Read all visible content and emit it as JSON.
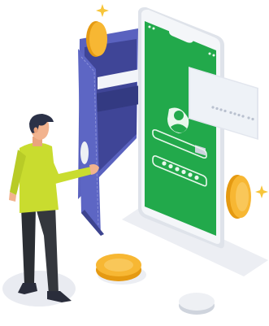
{
  "illustration": {
    "palette": {
      "screen": "#22a94b",
      "phone_frame": "#eef0f4",
      "wallet": "#4e56b2",
      "wallet_inner": "#3f4597",
      "coin": "#f7b733",
      "coin_dark": "#e59a12",
      "card": "#eef2f7",
      "shirt": "#c9dc2f",
      "hair": "#2b3147",
      "pants": "#2b2e33",
      "skin": "#f2b38f",
      "shadow": "#e9ebf1",
      "sparkle": "#f7c53a"
    },
    "icons": [
      "sparkle-icon",
      "user-avatar-icon",
      "password-dots-icon"
    ],
    "password_dots": 6
  }
}
